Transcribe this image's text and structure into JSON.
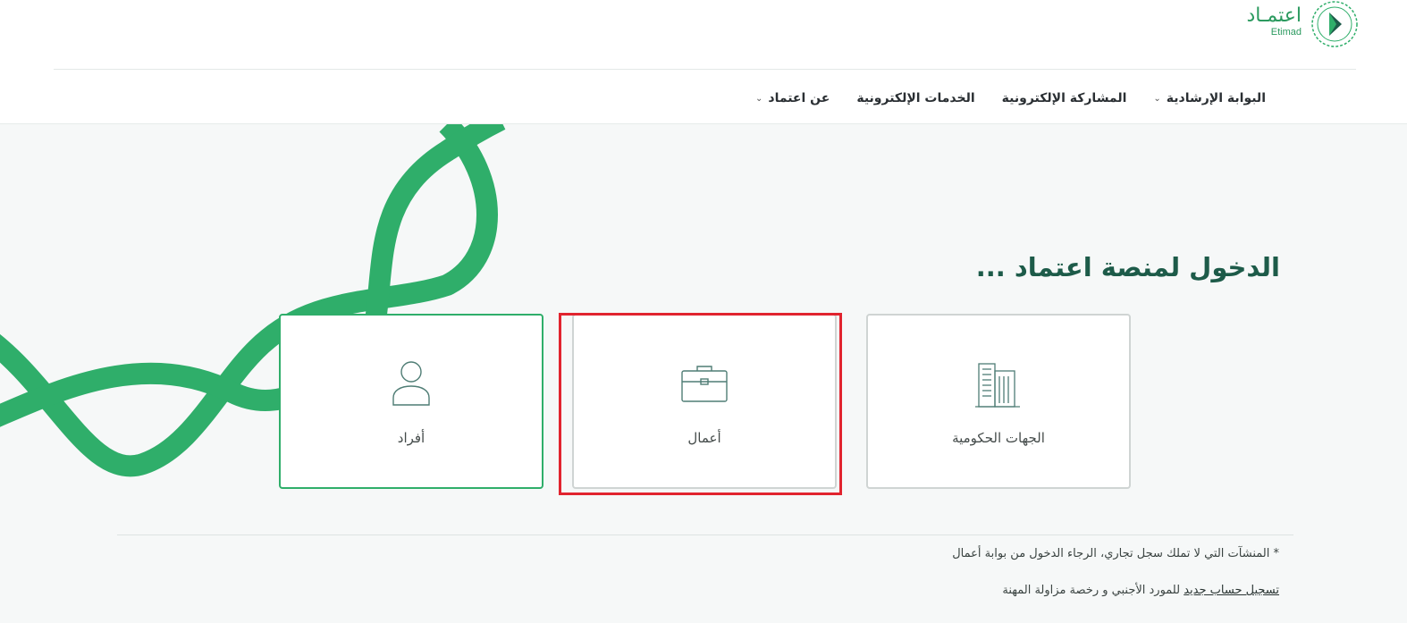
{
  "brand": {
    "name_ar": "اعتمـاد",
    "name_en": "Etimad"
  },
  "nav": {
    "items": [
      {
        "label": "عن اعتماد",
        "has_dropdown": true
      },
      {
        "label": "الخدمات الإلكترونية",
        "has_dropdown": false
      },
      {
        "label": "المشاركة الإلكترونية",
        "has_dropdown": false
      },
      {
        "label": "البوابة الإرشادية",
        "has_dropdown": true
      }
    ]
  },
  "main": {
    "title": "الدخول لمنصة اعتماد ...",
    "cards": [
      {
        "label": "الجهات الحكومية",
        "icon": "government-building-icon"
      },
      {
        "label": "أعمال",
        "icon": "briefcase-icon",
        "highlighted": true
      },
      {
        "label": "أفراد",
        "icon": "person-icon"
      }
    ]
  },
  "footer": {
    "note": "* المنشآت التي لا تملك سجل تجاري، الرجاء الدخول من بوابة أعمال",
    "register_link": "تسجيل حساب جديد",
    "register_rest": " للمورد الأجنبي و رخصة مزاولة المهنة"
  },
  "colors": {
    "brand_green": "#2fae6a",
    "title_green": "#1d5b49",
    "highlight_red": "#e1242f"
  }
}
